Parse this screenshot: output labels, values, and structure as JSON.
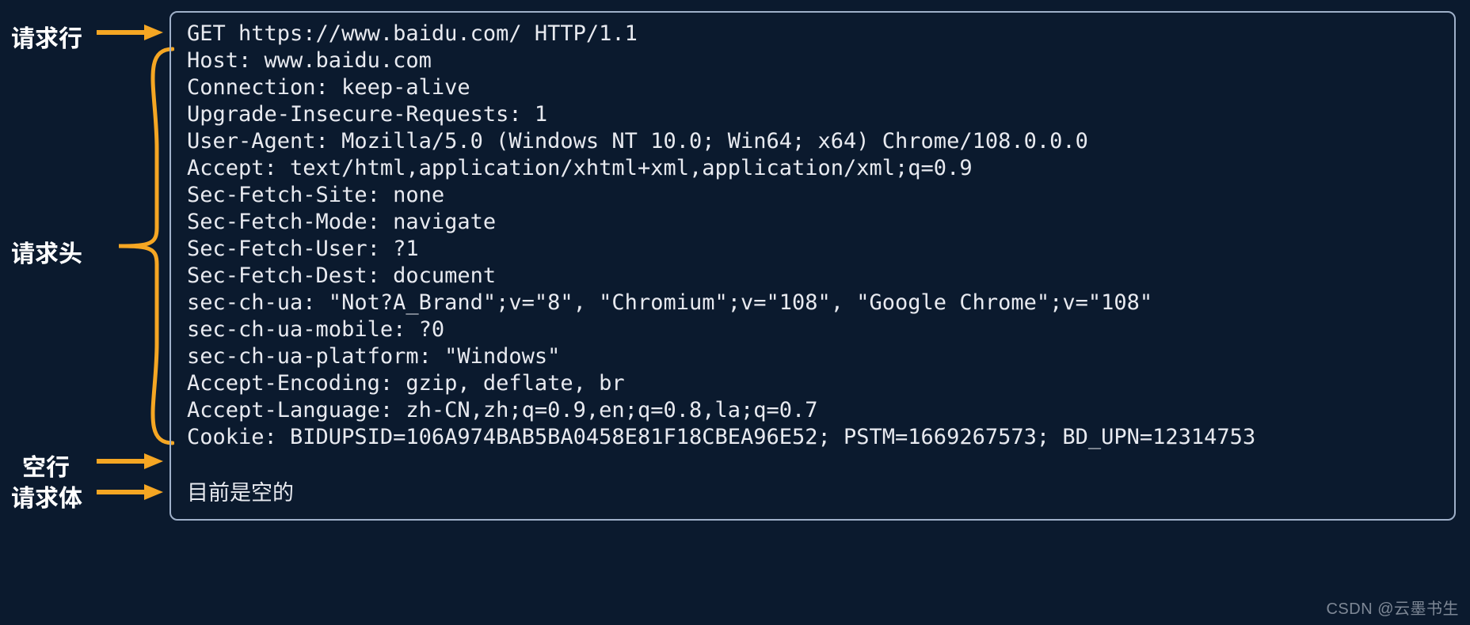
{
  "labels": {
    "request_line": "请求行",
    "request_headers": "请求头",
    "blank_line": "空行",
    "request_body": "请求体"
  },
  "request_line": "GET https://www.baidu.com/ HTTP/1.1",
  "headers": [
    "Host: www.baidu.com",
    "Connection: keep-alive",
    "Upgrade-Insecure-Requests: 1",
    "User-Agent: Mozilla/5.0 (Windows NT 10.0; Win64; x64) Chrome/108.0.0.0",
    "Accept: text/html,application/xhtml+xml,application/xml;q=0.9",
    "Sec-Fetch-Site: none",
    "Sec-Fetch-Mode: navigate",
    "Sec-Fetch-User: ?1",
    "Sec-Fetch-Dest: document",
    "sec-ch-ua: \"Not?A_Brand\";v=\"8\", \"Chromium\";v=\"108\", \"Google Chrome\";v=\"108\"",
    "sec-ch-ua-mobile: ?0",
    "sec-ch-ua-platform: \"Windows\"",
    "Accept-Encoding: gzip, deflate, br",
    "Accept-Language: zh-CN,zh;q=0.9,en;q=0.8,la;q=0.7",
    "Cookie: BIDUPSID=106A974BAB5BA0458E81F18CBEA96E52; PSTM=1669267573; BD_UPN=12314753"
  ],
  "body_text": "目前是空的",
  "watermark": "CSDN @云墨书生"
}
